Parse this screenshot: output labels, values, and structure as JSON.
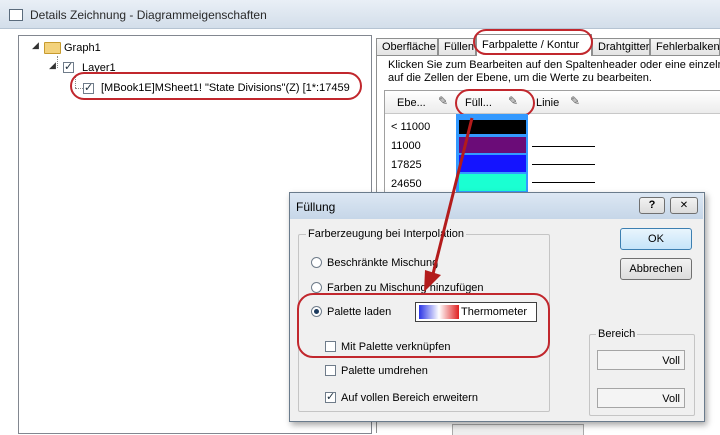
{
  "window": {
    "title": "Details Zeichnung - Diagrammeigenschaften"
  },
  "tree": {
    "graph": "Graph1",
    "layer": "Layer1",
    "plot": "[MBook1E]MSheet1! \"State Divisions\"(Z) [1*:17459"
  },
  "tabs": [
    "Oberfläche",
    "Füllen",
    "Farbpalette / Kontur",
    "Drahtgitter",
    "Fehlerbalken"
  ],
  "instructions": "Klicken Sie zum Bearbeiten auf den Spaltenheader oder eine einzelne Zelle auf die Zellen der Ebene, um die Werte zu bearbeiten.",
  "instr_line1": "Klicken Sie zum Bearbeiten auf den Spaltenheader oder eine einzelne",
  "instr_line2": "auf die Zellen der Ebene, um die Werte zu bearbeiten.",
  "grid": {
    "headers": [
      "Ebe...",
      "Füll...",
      "Linie"
    ],
    "rows": [
      {
        "level": "< 11000",
        "color": "#000000"
      },
      {
        "level": "11000",
        "color": "#6b0c78"
      },
      {
        "level": "17825",
        "color": "#1414ff"
      },
      {
        "level": "24650",
        "color": "#1affd2"
      }
    ]
  },
  "dialog": {
    "title": "Füllung",
    "help": "?",
    "close": "✕",
    "group": "Farberzeugung bei Interpolation",
    "opt1": "Beschränkte Mischung",
    "opt2": "Farben zu Mischung hinzufügen",
    "opt3": "Palette laden",
    "palette": "Thermometer",
    "link": "Mit Palette verknüpfen",
    "reverse": "Palette umdrehen",
    "extend": "Auf vollen Bereich erweitern",
    "ok": "OK",
    "cancel": "Abbrechen",
    "range_label": "Bereich",
    "range1": "Voll",
    "range2": "Voll"
  },
  "colors": {
    "annotation": "#c1272d",
    "selection": "#3399ff"
  }
}
